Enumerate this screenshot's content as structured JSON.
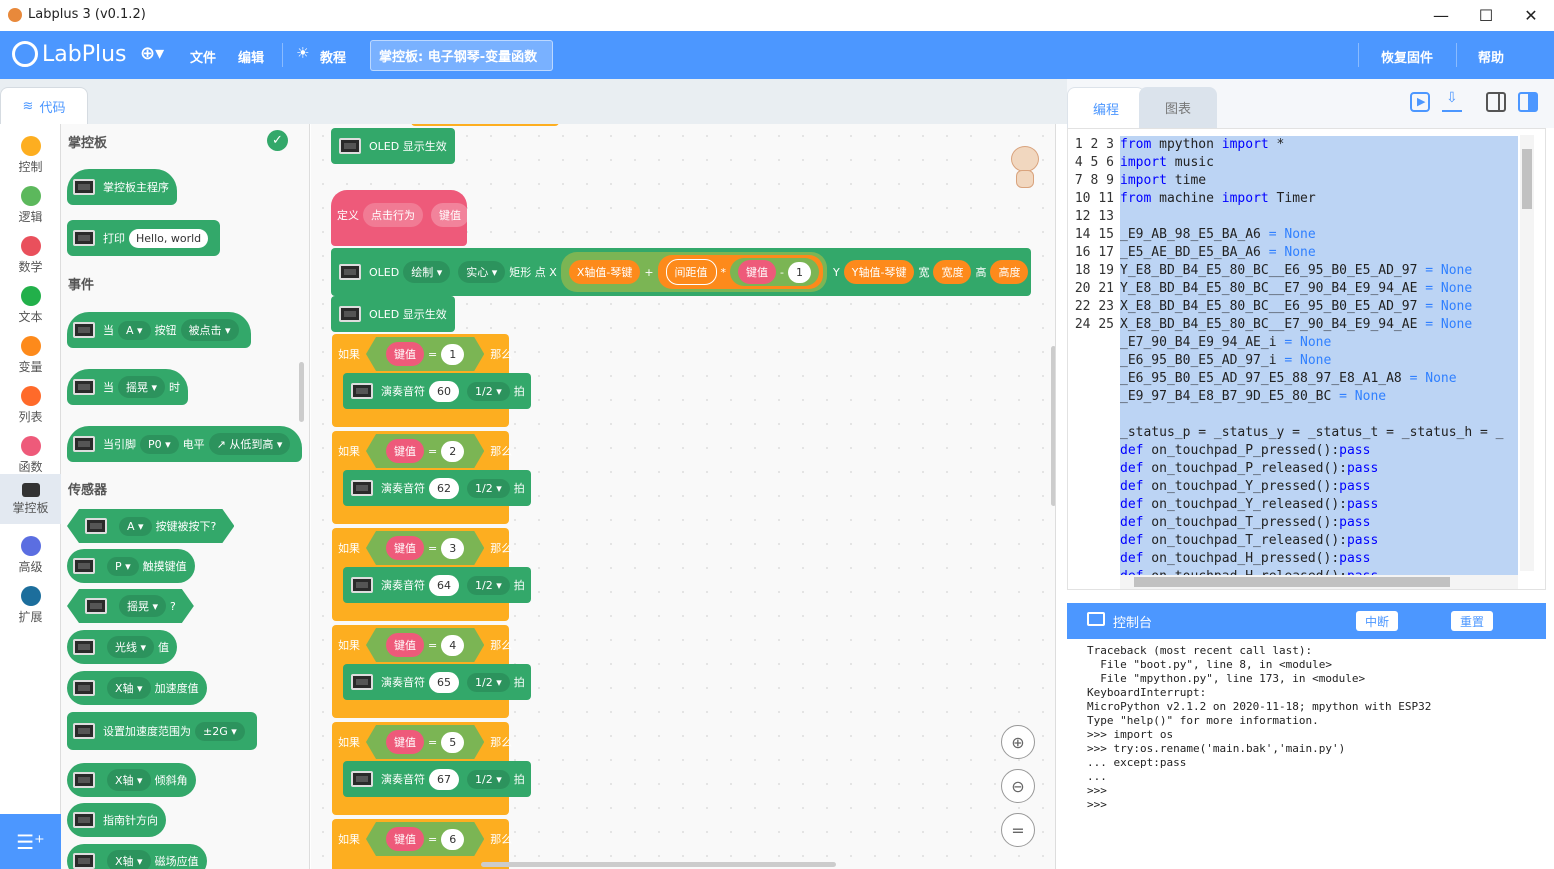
{
  "window": {
    "title": "Labplus 3 (v0.1.2)"
  },
  "menu": {
    "logo": "LabPlus",
    "file": "文件",
    "edit": "编辑",
    "tutorial": "教程",
    "project": "掌控板: 电子钢琴-变量函数",
    "restore": "恢复固件",
    "help": "帮助"
  },
  "code_tab": "代码",
  "categories": [
    {
      "label": "控制",
      "color": "#fdae20"
    },
    {
      "label": "逻辑",
      "color": "#5cb85c"
    },
    {
      "label": "数学",
      "color": "#e9505c"
    },
    {
      "label": "文本",
      "color": "#22b04a"
    },
    {
      "label": "变量",
      "color": "#fd8a1b"
    },
    {
      "label": "列表",
      "color": "#ff6a2a"
    },
    {
      "label": "函数",
      "color": "#ee5a7a"
    },
    {
      "label": "掌控板",
      "color": "#333333"
    },
    {
      "label": "高级",
      "color": "#5b6ee1"
    },
    {
      "label": "扩展",
      "color": "#1c6e9c"
    }
  ],
  "palette": {
    "h1": "掌控板",
    "main_program": "掌控板主程序",
    "print": "打印",
    "print_val": "Hello, world",
    "h2": "事件",
    "when": "当",
    "btn_a": "A",
    "button": "按钮",
    "clicked": "被点击",
    "shake": "摇晃",
    "time": "时",
    "when_pin": "当引脚",
    "p0": "P0",
    "level": "电平",
    "rising": "↗ 从低到高",
    "h3": "传感器",
    "pressed": "按键被按下?",
    "p": "P",
    "touch": "触摸键值",
    "shake2": "摇晃",
    "q": "?",
    "light": "光线",
    "value": "值",
    "xaxis": "X轴",
    "accel": "加速度值",
    "set_accel": "设置加速度范围为",
    "g2": "±2G",
    "xaxis2": "X轴",
    "tilt": "倾斜角",
    "compass": "指南针方向",
    "xaxis3": "X轴",
    "magnet": "磁场应值"
  },
  "ws": {
    "oled_show": "OLED 显示生效",
    "define": "定义",
    "click_action": "点击行为",
    "key_val": "键值",
    "oled": "OLED",
    "draw": "绘制",
    "solid": "实心",
    "rect_x": "矩形 点 X",
    "x_val": "X轴值-琴键",
    "plus": "+",
    "spacing": "间距值",
    "times": "*",
    "minus": "-",
    "one": "1",
    "y": "Y",
    "y_val": "Y轴值-琴键",
    "width_l": "宽",
    "width": "宽度",
    "height_l": "高",
    "height": "高度",
    "if": "如果",
    "eq": "=",
    "then": "那么",
    "play_note": "演奏音符",
    "half": "1/2",
    "beat": "拍",
    "ifs": [
      {
        "k": "1",
        "n": "60"
      },
      {
        "k": "2",
        "n": "62"
      },
      {
        "k": "3",
        "n": "64"
      },
      {
        "k": "4",
        "n": "65"
      },
      {
        "k": "5",
        "n": "67"
      },
      {
        "k": "6",
        "n": ""
      }
    ]
  },
  "right": {
    "tab_code": "编程",
    "tab_chart": "图表"
  },
  "code_lines": [
    "from mpython import *",
    "import music",
    "import time",
    "from machine import Timer",
    "",
    "_E9_AB_98_E5_BA_A6 = None",
    "_E5_AE_BD_E5_BA_A6 = None",
    "Y_E8_BD_B4_E5_80_BC__E6_95_B0_E5_AD_97 = None",
    "Y_E8_BD_B4_E5_80_BC__E7_90_B4_E9_94_AE = None",
    "X_E8_BD_B4_E5_80_BC__E6_95_B0_E5_AD_97 = None",
    "X_E8_BD_B4_E5_80_BC__E7_90_B4_E9_94_AE = None",
    "_E7_90_B4_E9_94_AE_i = None",
    "_E6_95_B0_E5_AD_97_i = None",
    "_E6_95_B0_E5_AD_97_E5_88_97_E8_A1_A8 = None",
    "_E9_97_B4_E8_B7_9D_E5_80_BC = None",
    "",
    "_status_p = _status_y = _status_t = _status_h = _",
    "def on_touchpad_P_pressed():pass",
    "def on_touchpad_P_released():pass",
    "def on_touchpad_Y_pressed():pass",
    "def on_touchpad_Y_released():pass",
    "def on_touchpad_T_pressed():pass",
    "def on_touchpad_T_released():pass",
    "def on_touchpad_H_pressed():pass",
    "def on_touchpad_H_released():pass"
  ],
  "console": {
    "title": "控制台",
    "interrupt": "中断",
    "reset": "重置",
    "lines": [
      "Traceback (most recent call last):",
      "  File \"boot.py\", line 8, in <module>",
      "  File \"mpython.py\", line 173, in <module>",
      "KeyboardInterrupt:",
      "MicroPython v2.1.2 on 2020-11-18; mpython with ESP32",
      "Type \"help()\" for more information.",
      ">>> import os",
      ">>> try:os.rename('main.bak','main.py')",
      "... except:pass",
      "...",
      ">>>",
      ">>>"
    ]
  }
}
